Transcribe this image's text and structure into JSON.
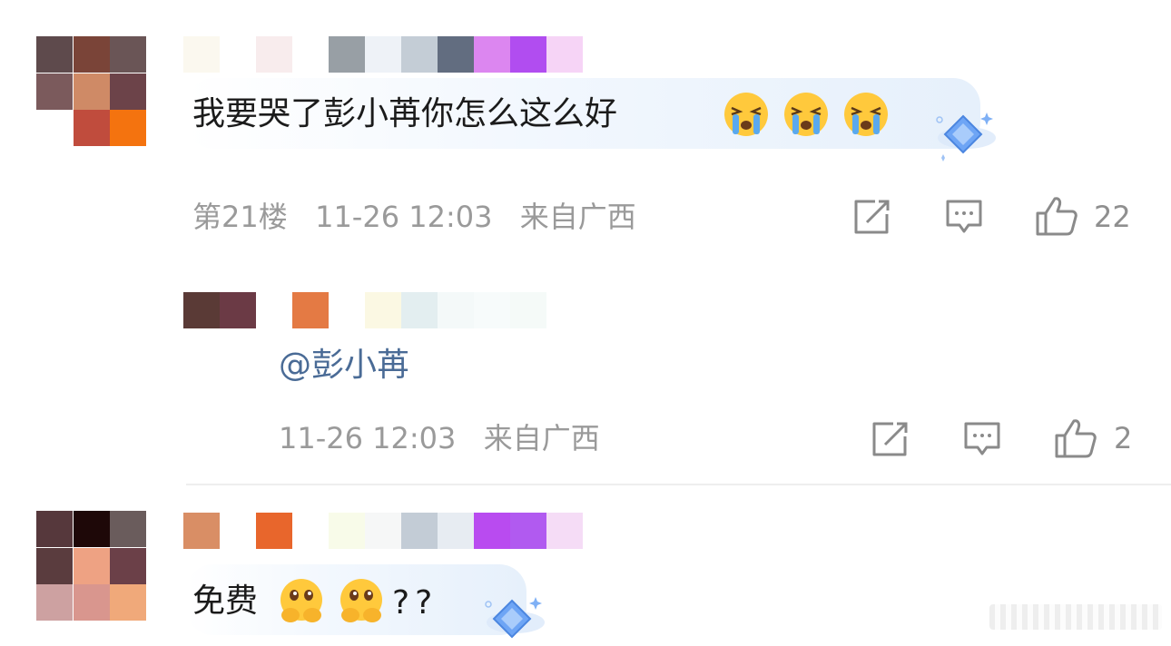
{
  "comments": [
    {
      "text": "我要哭了彭小苒你怎么这么好",
      "emoji": "crying-face-emoji",
      "floor": "第21楼",
      "time": "11-26 12:03",
      "location": "来自广西",
      "likes": "22"
    },
    {
      "text": "免费",
      "emoji": "pleading-face-emoji",
      "suffix": "??"
    }
  ],
  "reply": {
    "mention": "@彭小苒",
    "time": "11-26 12:03",
    "location": "来自广西",
    "likes": "2"
  },
  "icons": {
    "share": "share-icon",
    "comment": "comment-icon",
    "like": "thumbs-up-icon",
    "badge": "diamond-badge-icon"
  },
  "colors": {
    "text": "#1b1b1b",
    "meta": "#9a9a9a",
    "mention": "#4a6b96",
    "bubble": "#e6f0fb"
  }
}
